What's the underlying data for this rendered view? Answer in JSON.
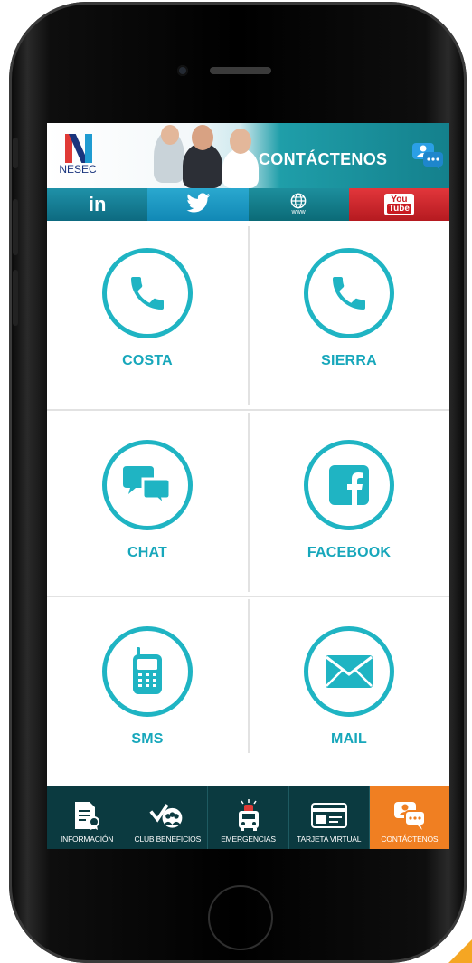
{
  "header": {
    "logo_text": "NESEC",
    "title": "CONTÁCTENOS"
  },
  "social": [
    {
      "name": "linkedin",
      "label": "in"
    },
    {
      "name": "twitter",
      "label": ""
    },
    {
      "name": "web",
      "label": "www"
    },
    {
      "name": "youtube",
      "label_top": "You",
      "label_bottom": "Tube"
    }
  ],
  "contacts": {
    "costa": "COSTA",
    "sierra": "SIERRA",
    "chat": "CHAT",
    "facebook": "FACEBOOK",
    "sms": "SMS",
    "mail": "MAIL"
  },
  "bottom_nav": {
    "informacion": "INFORMACIÓN",
    "club": "CLUB BENEFICIOS",
    "emergencias": "EMERGENCIAS",
    "tarjeta": "TARJETA VIRTUAL",
    "contactenos": "CONTÁCTENOS"
  },
  "colors": {
    "accent": "#1fb4c3",
    "nav_bg": "#0b3a40",
    "nav_active": "#f07f22",
    "youtube": "#c91a21"
  }
}
